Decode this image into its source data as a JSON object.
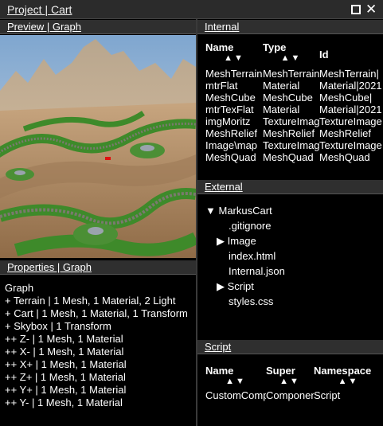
{
  "window": {
    "title": "Project | Cart"
  },
  "preview": {
    "header": "Preview | Graph"
  },
  "properties": {
    "header": "Properties | Graph",
    "lines": [
      "Graph",
      "+ Terrain | 1 Mesh, 1 Material, 2 Light",
      "+ Cart | 1 Mesh, 1 Material, 1 Transform",
      "+ Skybox | 1 Transform",
      "++ Z- | 1 Mesh, 1 Material",
      "++ X- | 1 Mesh, 1 Material",
      "++ X+ | 1 Mesh, 1 Material",
      "++ Z+ | 1 Mesh, 1 Material",
      "++ Y+ | 1 Mesh, 1 Material",
      "++ Y- | 1 Mesh, 1 Material"
    ]
  },
  "internal": {
    "header": "Internal",
    "columns": [
      "Name",
      "Type",
      "Id"
    ],
    "sort_glyph": "▲▼",
    "rows": [
      [
        "MeshTerrain",
        "MeshTerrain",
        "MeshTerrain|"
      ],
      [
        "mtrFlat",
        "Material",
        "Material|2021"
      ],
      [
        "MeshCube",
        "MeshCube",
        "MeshCube|"
      ],
      [
        "mtrTexFlat",
        "Material",
        "Material|2021"
      ],
      [
        "imgMoritz",
        "TextureImage",
        "TextureImage"
      ],
      [
        "MeshRelief",
        "MeshRelief",
        "MeshRelief"
      ],
      [
        "Image\\map",
        "TextureImage",
        "TextureImage"
      ],
      [
        "MeshQuad",
        "MeshQuad",
        "MeshQuad"
      ]
    ]
  },
  "external": {
    "header": "External",
    "tree": [
      {
        "label": "MarkusCart",
        "marker": "▼",
        "indent": 0
      },
      {
        "label": ".gitignore",
        "marker": "",
        "indent": 2
      },
      {
        "label": "Image",
        "marker": "▶",
        "indent": 1
      },
      {
        "label": "index.html",
        "marker": "",
        "indent": 2
      },
      {
        "label": "Internal.json",
        "marker": "",
        "indent": 2
      },
      {
        "label": "Script",
        "marker": "▶",
        "indent": 1
      },
      {
        "label": "styles.css",
        "marker": "",
        "indent": 2
      }
    ]
  },
  "script": {
    "header": "Script",
    "columns": [
      "Name",
      "Super",
      "Namespace"
    ],
    "sort_glyph": "▲▼",
    "rows": [
      [
        "CustomComponentScript",
        "ComponentScript",
        "Script"
      ]
    ]
  },
  "colors": {
    "background": "#000000",
    "header_bg": "#2f2f2f",
    "text": "#ffffff",
    "terrain_grass": "#3e8a2a",
    "sky": "#8fb3d6"
  }
}
